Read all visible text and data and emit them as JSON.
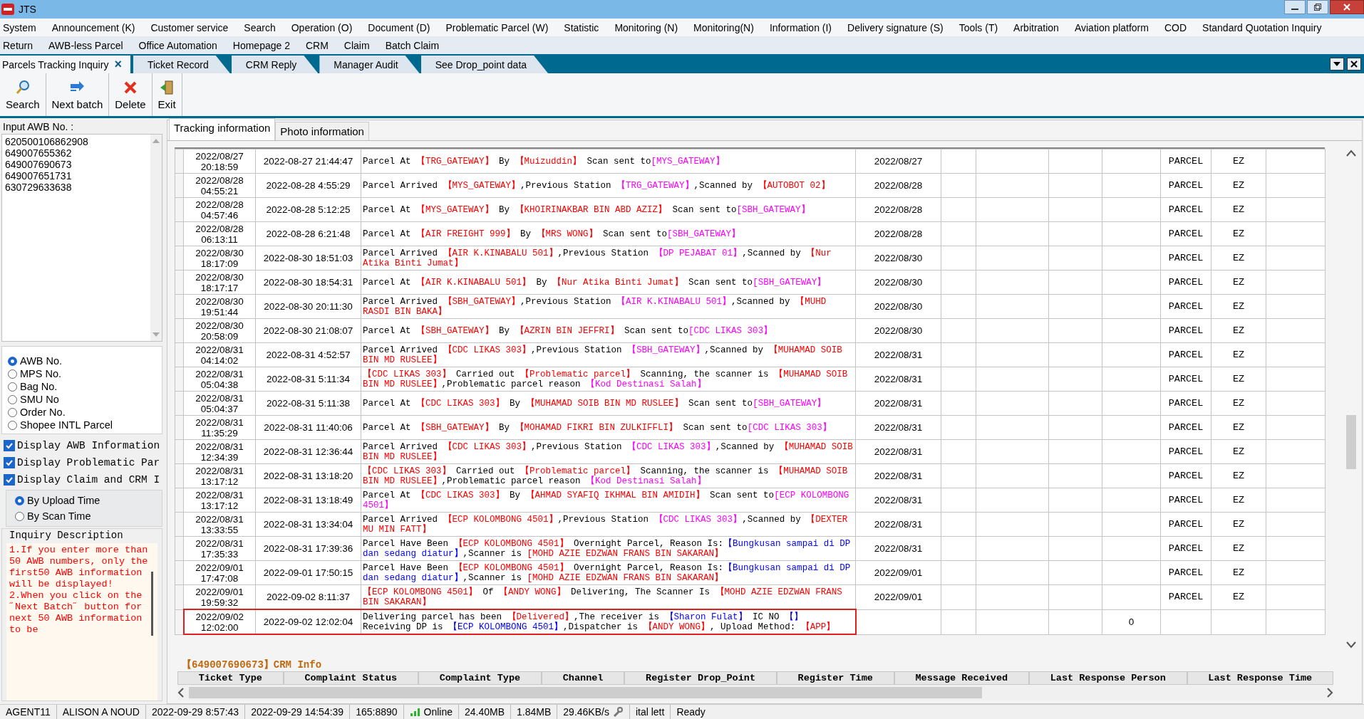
{
  "window": {
    "title": "JTS"
  },
  "menu_rows": [
    [
      "System",
      "Announcement (K)",
      "Customer service",
      "Search",
      "Operation (O)",
      "Document (D)",
      "Problematic Parcel (W)",
      "Statistic",
      "Monitoring (N)",
      "Monitoring(N)",
      "Information (I)",
      "Delivery signature (S)",
      "Tools (T)",
      "Arbitration",
      "Aviation platform",
      "COD",
      "Standard Quotation Inquiry"
    ],
    [
      "Return",
      "AWB-less Parcel",
      "Office Automation",
      "Homepage 2",
      "CRM",
      "Claim",
      "Batch Claim"
    ]
  ],
  "doc_tabs": [
    {
      "label": "Parcels Tracking Inquiry",
      "selected": true,
      "close": "×"
    },
    {
      "label": "Ticket Record",
      "selected": false
    },
    {
      "label": "CRM Reply",
      "selected": false
    },
    {
      "label": "Manager Audit",
      "selected": false
    },
    {
      "label": "See Drop_point data",
      "selected": false
    }
  ],
  "toolbar": [
    {
      "label": "Search",
      "kind": "search"
    },
    {
      "label": "Next batch",
      "kind": "next"
    },
    {
      "label": "Delete",
      "kind": "delete"
    },
    {
      "label": "Exit",
      "kind": "exit"
    }
  ],
  "left_panel": {
    "input_label": "Input AWB No. :",
    "awb_numbers": [
      "620500106862908",
      "649007655362",
      "649007690673",
      "649007651731",
      "630729633638"
    ],
    "search_by": [
      {
        "label": "AWB No.",
        "selected": true
      },
      {
        "label": "MPS No.",
        "selected": false
      },
      {
        "label": "Bag No.",
        "selected": false
      },
      {
        "label": "SMU No",
        "selected": false
      },
      {
        "label": "Order No.",
        "selected": false
      },
      {
        "label": "Shopee INTL Parcel",
        "selected": false
      }
    ],
    "options": [
      {
        "label": "Display AWB Information",
        "checked": true
      },
      {
        "label": "Display Problematic Par",
        "checked": true
      },
      {
        "label": "Display Claim and CRM I",
        "checked": true
      }
    ],
    "sort_by": [
      {
        "label": "By Upload Time",
        "selected": true
      },
      {
        "label": "By Scan Time",
        "selected": false
      }
    ],
    "description_title": "Inquiry Description",
    "description": [
      "1.If you enter more than  50  AWB numbers, only the first50  AWB information will be displayed!",
      "2.When you click on the ˝Next Batch˝ button for next  50 AWB information to be"
    ]
  },
  "info_tabs": [
    {
      "label": "Tracking information",
      "selected": true
    },
    {
      "label": "Photo information",
      "selected": false
    }
  ],
  "rows": [
    {
      "scan_time": "2022/08/27 20:18:59",
      "upload_time": "2022-08-27 21:44:47",
      "date": "2022/08/27",
      "type": "PARCEL",
      "code": "EZ",
      "highlighted": false,
      "description": [
        {
          "text": "Parcel At ",
          "color": "#000000"
        },
        {
          "text": "【TRG_GATEWAY】",
          "color": "#ff0000"
        },
        {
          "text": " By ",
          "color": "#000000"
        },
        {
          "text": "【Muizuddin】",
          "color": "#ff0000"
        },
        {
          "text": " Scan sent to",
          "color": "#000000"
        },
        {
          "text": "[MYS_GATEWAY】",
          "color": "#ff00ff"
        }
      ]
    },
    {
      "scan_time": "2022/08/28 04:55:21",
      "upload_time": "2022-08-28 4:55:29",
      "date": "2022/08/28",
      "type": "PARCEL",
      "code": "EZ",
      "highlighted": false,
      "description": [
        {
          "text": "Parcel Arrived ",
          "color": "#000000"
        },
        {
          "text": "【MYS_GATEWAY】",
          "color": "#ff0000"
        },
        {
          "text": ",Previous Station ",
          "color": "#000000"
        },
        {
          "text": "【TRG_GATEWAY】",
          "color": "#ff00ff"
        },
        {
          "text": ",Scanned by ",
          "color": "#000000"
        },
        {
          "text": "【AUTOBOT 02】",
          "color": "#ff0000"
        }
      ]
    },
    {
      "scan_time": "2022/08/28 04:57:46",
      "upload_time": "2022-08-28 5:12:25",
      "date": "2022/08/28",
      "type": "PARCEL",
      "code": "EZ",
      "highlighted": false,
      "description": [
        {
          "text": "Parcel At ",
          "color": "#000000"
        },
        {
          "text": "【MYS_GATEWAY】",
          "color": "#ff0000"
        },
        {
          "text": " By ",
          "color": "#000000"
        },
        {
          "text": "【KHOIRINAKBAR BIN ABD AZIZ】",
          "color": "#ff0000"
        },
        {
          "text": " Scan sent to",
          "color": "#000000"
        },
        {
          "text": "[SBH_GATEWAY】",
          "color": "#ff00ff"
        }
      ]
    },
    {
      "scan_time": "2022/08/28 06:13:11",
      "upload_time": "2022-08-28 6:21:48",
      "date": "2022/08/28",
      "type": "PARCEL",
      "code": "EZ",
      "highlighted": false,
      "description": [
        {
          "text": "Parcel At ",
          "color": "#000000"
        },
        {
          "text": "【AIR FREIGHT 999】",
          "color": "#ff0000"
        },
        {
          "text": " By ",
          "color": "#000000"
        },
        {
          "text": "【MRS WONG】",
          "color": "#ff0000"
        },
        {
          "text": " Scan sent to",
          "color": "#000000"
        },
        {
          "text": "[SBH_GATEWAY】",
          "color": "#ff00ff"
        }
      ]
    },
    {
      "scan_time": "2022/08/30 18:17:09",
      "upload_time": "2022-08-30 18:51:03",
      "date": "2022/08/30",
      "type": "PARCEL",
      "code": "EZ",
      "highlighted": false,
      "description": [
        {
          "text": "Parcel Arrived ",
          "color": "#000000"
        },
        {
          "text": "【AIR K.KINABALU 501】",
          "color": "#ff0000"
        },
        {
          "text": ",Previous Station ",
          "color": "#000000"
        },
        {
          "text": "【DP PEJABAT 01】",
          "color": "#ff00ff"
        },
        {
          "text": ",Scanned by ",
          "color": "#000000"
        },
        {
          "text": "【Nur Atika Binti Jumat】",
          "color": "#ff0000"
        }
      ]
    },
    {
      "scan_time": "2022/08/30 18:17:17",
      "upload_time": "2022-08-30 18:54:31",
      "date": "2022/08/30",
      "type": "PARCEL",
      "code": "EZ",
      "highlighted": false,
      "description": [
        {
          "text": "Parcel At ",
          "color": "#000000"
        },
        {
          "text": "【AIR K.KINABALU 501】",
          "color": "#ff0000"
        },
        {
          "text": " By ",
          "color": "#000000"
        },
        {
          "text": "【Nur Atika Binti Jumat】",
          "color": "#ff0000"
        },
        {
          "text": " Scan sent to",
          "color": "#000000"
        },
        {
          "text": "[SBH_GATEWAY】",
          "color": "#ff00ff"
        }
      ]
    },
    {
      "scan_time": "2022/08/30 19:51:44",
      "upload_time": "2022-08-30 20:11:30",
      "date": "2022/08/30",
      "type": "PARCEL",
      "code": "EZ",
      "highlighted": false,
      "description": [
        {
          "text": "Parcel Arrived ",
          "color": "#000000"
        },
        {
          "text": "【SBH_GATEWAY】",
          "color": "#ff0000"
        },
        {
          "text": ",Previous Station ",
          "color": "#000000"
        },
        {
          "text": "【AIR K.KINABALU 501】",
          "color": "#ff00ff"
        },
        {
          "text": ",Scanned by ",
          "color": "#000000"
        },
        {
          "text": "【MUHD RASDI BIN BAKA】",
          "color": "#ff0000"
        }
      ]
    },
    {
      "scan_time": "2022/08/30 20:58:09",
      "upload_time": "2022-08-30 21:08:07",
      "date": "2022/08/30",
      "type": "PARCEL",
      "code": "EZ",
      "highlighted": false,
      "description": [
        {
          "text": "Parcel At ",
          "color": "#000000"
        },
        {
          "text": "【SBH_GATEWAY】",
          "color": "#ff0000"
        },
        {
          "text": " By ",
          "color": "#000000"
        },
        {
          "text": "【AZRIN BIN JEFFRI】",
          "color": "#ff0000"
        },
        {
          "text": " Scan sent to",
          "color": "#000000"
        },
        {
          "text": "[CDC LIKAS 303】",
          "color": "#ff00ff"
        }
      ]
    },
    {
      "scan_time": "2022/08/31 04:14:02",
      "upload_time": "2022-08-31 4:52:57",
      "date": "2022/08/31",
      "type": "PARCEL",
      "code": "EZ",
      "highlighted": false,
      "description": [
        {
          "text": "Parcel Arrived ",
          "color": "#000000"
        },
        {
          "text": "【CDC LIKAS 303】",
          "color": "#ff0000"
        },
        {
          "text": ",Previous Station ",
          "color": "#000000"
        },
        {
          "text": "【SBH_GATEWAY】",
          "color": "#ff00ff"
        },
        {
          "text": ",Scanned by ",
          "color": "#000000"
        },
        {
          "text": "【MUHAMAD SOIB BIN MD RUSLEE】",
          "color": "#ff0000"
        }
      ]
    },
    {
      "scan_time": "2022/08/31 05:04:38",
      "upload_time": "2022-08-31 5:11:34",
      "date": "2022/08/31",
      "type": "PARCEL",
      "code": "EZ",
      "highlighted": false,
      "description": [
        {
          "text": "【CDC LIKAS 303】",
          "color": "#ff0000"
        },
        {
          "text": " Carried out ",
          "color": "#000000"
        },
        {
          "text": "【Problematic parcel】",
          "color": "#ff0000"
        },
        {
          "text": " Scanning, the scanner is ",
          "color": "#000000"
        },
        {
          "text": "【MUHAMAD SOIB BIN MD RUSLEE】",
          "color": "#ff0000"
        },
        {
          "text": ",Problematic parcel reason ",
          "color": "#000000"
        },
        {
          "text": "【Kod Destinasi Salah】",
          "color": "#ff00ff"
        }
      ]
    },
    {
      "scan_time": "2022/08/31 05:04:37",
      "upload_time": "2022-08-31 5:11:38",
      "date": "2022/08/31",
      "type": "PARCEL",
      "code": "EZ",
      "highlighted": false,
      "description": [
        {
          "text": "Parcel At ",
          "color": "#000000"
        },
        {
          "text": "【CDC LIKAS 303】",
          "color": "#ff0000"
        },
        {
          "text": " By ",
          "color": "#000000"
        },
        {
          "text": "【MUHAMAD SOIB BIN MD RUSLEE】",
          "color": "#ff0000"
        },
        {
          "text": " Scan sent to",
          "color": "#000000"
        },
        {
          "text": "[SBH_GATEWAY】",
          "color": "#ff00ff"
        }
      ]
    },
    {
      "scan_time": "2022/08/31 11:35:29",
      "upload_time": "2022-08-31 11:40:06",
      "date": "2022/08/31",
      "type": "PARCEL",
      "code": "EZ",
      "highlighted": false,
      "description": [
        {
          "text": "Parcel At ",
          "color": "#000000"
        },
        {
          "text": "【SBH_GATEWAY】",
          "color": "#ff0000"
        },
        {
          "text": " By ",
          "color": "#000000"
        },
        {
          "text": "【MOHAMAD FIKRI BIN ZULKIFFLI】",
          "color": "#ff0000"
        },
        {
          "text": " Scan sent to",
          "color": "#000000"
        },
        {
          "text": "[CDC LIKAS 303】",
          "color": "#ff00ff"
        }
      ]
    },
    {
      "scan_time": "2022/08/31 12:34:39",
      "upload_time": "2022-08-31 12:36:44",
      "date": "2022/08/31",
      "type": "PARCEL",
      "code": "EZ",
      "highlighted": false,
      "description": [
        {
          "text": "Parcel Arrived ",
          "color": "#000000"
        },
        {
          "text": "【CDC LIKAS 303】",
          "color": "#ff0000"
        },
        {
          "text": ",Previous Station ",
          "color": "#000000"
        },
        {
          "text": "【CDC LIKAS 303】",
          "color": "#ff00ff"
        },
        {
          "text": ",Scanned by ",
          "color": "#000000"
        },
        {
          "text": "【MUHAMAD SOIB BIN MD RUSLEE】",
          "color": "#ff0000"
        }
      ]
    },
    {
      "scan_time": "2022/08/31 13:17:12",
      "upload_time": "2022-08-31 13:18:20",
      "date": "2022/08/31",
      "type": "PARCEL",
      "code": "EZ",
      "highlighted": false,
      "description": [
        {
          "text": "【CDC LIKAS 303】",
          "color": "#ff0000"
        },
        {
          "text": " Carried out ",
          "color": "#000000"
        },
        {
          "text": "【Problematic parcel】",
          "color": "#ff0000"
        },
        {
          "text": " Scanning, the scanner is ",
          "color": "#000000"
        },
        {
          "text": "【MUHAMAD SOIB BIN MD RUSLEE】",
          "color": "#ff0000"
        },
        {
          "text": ",Problematic parcel reason ",
          "color": "#000000"
        },
        {
          "text": "【Kod Destinasi Salah】",
          "color": "#ff00ff"
        }
      ]
    },
    {
      "scan_time": "2022/08/31 13:17:12",
      "upload_time": "2022-08-31 13:18:49",
      "date": "2022/08/31",
      "type": "PARCEL",
      "code": "EZ",
      "highlighted": false,
      "description": [
        {
          "text": "Parcel At ",
          "color": "#000000"
        },
        {
          "text": "【CDC LIKAS 303】",
          "color": "#ff0000"
        },
        {
          "text": " By ",
          "color": "#000000"
        },
        {
          "text": "【AHMAD SYAFIQ IKHMAL BIN AMIDIH】",
          "color": "#ff0000"
        },
        {
          "text": " Scan sent to",
          "color": "#000000"
        },
        {
          "text": "[ECP KOLOMBONG 4501】",
          "color": "#ff00ff"
        }
      ]
    },
    {
      "scan_time": "2022/08/31 13:33:55",
      "upload_time": "2022-08-31 13:34:04",
      "date": "2022/08/31",
      "type": "PARCEL",
      "code": "EZ",
      "highlighted": false,
      "description": [
        {
          "text": "Parcel Arrived ",
          "color": "#000000"
        },
        {
          "text": "【ECP KOLOMBONG 4501】",
          "color": "#ff0000"
        },
        {
          "text": ",Previous Station ",
          "color": "#000000"
        },
        {
          "text": "【CDC LIKAS 303】",
          "color": "#ff00ff"
        },
        {
          "text": ",Scanned by ",
          "color": "#000000"
        },
        {
          "text": "【DEXTER MU MIN FATT】",
          "color": "#ff0000"
        }
      ]
    },
    {
      "scan_time": "2022/08/31 17:35:33",
      "upload_time": "2022-08-31 17:39:36",
      "date": "2022/08/31",
      "type": "PARCEL",
      "code": "EZ",
      "highlighted": false,
      "description": [
        {
          "text": "Parcel Have Been ",
          "color": "#000000"
        },
        {
          "text": "【ECP KOLOMBONG 4501】",
          "color": "#ff0000"
        },
        {
          "text": " Overnight Parcel, Reason Is:",
          "color": "#000000"
        },
        {
          "text": "【Bungkusan sampai di DP dan sedang diatur】",
          "color": "#0000ff"
        },
        {
          "text": ",Scanner is ",
          "color": "#000000"
        },
        {
          "text": "[MOHD AZIE EDZWAN FRANS BIN SAKARAN】",
          "color": "#ff0000"
        }
      ]
    },
    {
      "scan_time": "2022/09/01 17:47:08",
      "upload_time": "2022-09-01 17:50:15",
      "date": "2022/09/01",
      "type": "PARCEL",
      "code": "EZ",
      "highlighted": false,
      "description": [
        {
          "text": "Parcel Have Been ",
          "color": "#000000"
        },
        {
          "text": "【ECP KOLOMBONG 4501】",
          "color": "#ff0000"
        },
        {
          "text": " Overnight Parcel, Reason Is:",
          "color": "#000000"
        },
        {
          "text": "【Bungkusan sampai di DP dan sedang diatur】",
          "color": "#0000ff"
        },
        {
          "text": ",Scanner is ",
          "color": "#000000"
        },
        {
          "text": "[MOHD AZIE EDZWAN FRANS BIN SAKARAN】",
          "color": "#ff0000"
        }
      ]
    },
    {
      "scan_time": "2022/09/01 19:59:32",
      "upload_time": "2022-09-02 8:11:37",
      "date": "2022/09/01",
      "type": "PARCEL",
      "code": "EZ",
      "highlighted": false,
      "description": [
        {
          "text": "【ECP KOLOMBONG 4501】",
          "color": "#ff0000"
        },
        {
          "text": " Of ",
          "color": "#000000"
        },
        {
          "text": "【ANDY WONG】",
          "color": "#ff0000"
        },
        {
          "text": " Delivering, The Scanner Is ",
          "color": "#000000"
        },
        {
          "text": "【MOHD AZIE EDZWAN FRANS BIN SAKARAN】",
          "color": "#ff0000"
        }
      ]
    },
    {
      "scan_time": "2022/09/02 12:02:00",
      "upload_time": "2022-09-02 12:02:04",
      "count": "0",
      "highlighted": true,
      "description": [
        {
          "text": "Delivering parcel has been ",
          "color": "#000000"
        },
        {
          "text": "【Delivered】",
          "color": "#ff0000"
        },
        {
          "text": ",The receiver is ",
          "color": "#000000"
        },
        {
          "text": "【Sharon Fulat】",
          "color": "#0000ff"
        },
        {
          "text": " IC NO ",
          "color": "#000000"
        },
        {
          "text": "【】",
          "color": "#0000ff"
        },
        {
          "text": " Receiving DP is ",
          "color": "#000000"
        },
        {
          "text": "【ECP KOLOMBONG 4501】",
          "color": "#0000ff"
        },
        {
          "text": ",Dispatcher is ",
          "color": "#000000"
        },
        {
          "text": "【ANDY WONG】",
          "color": "#ff0000"
        },
        {
          "text": ", Upload Method: ",
          "color": "#000000"
        },
        {
          "text": "【APP】",
          "color": "#ff0000"
        }
      ]
    }
  ],
  "crm": {
    "title": "【649007690673】CRM Info",
    "columns": [
      "Ticket Type",
      "Complaint Status",
      "Complaint Type",
      "Channel",
      "Register Drop_Point",
      "Register Time",
      "Message Received",
      "Last Response Person",
      "Last Response Time"
    ]
  },
  "status_bar": [
    {
      "text": "AGENT11"
    },
    {
      "text": "ALISON A NOUD"
    },
    {
      "text": "2022-09-29 8:57:43"
    },
    {
      "text": "2022-09-29 14:54:39"
    },
    {
      "text": "165:8890"
    },
    {
      "text": "Online",
      "kind": "signal"
    },
    {
      "text": "24.40MB"
    },
    {
      "text": "1.84MB"
    },
    {
      "text": "29.46KB/s",
      "kind": "tool"
    },
    {
      "text": "ital lett"
    },
    {
      "text": "Ready"
    }
  ]
}
